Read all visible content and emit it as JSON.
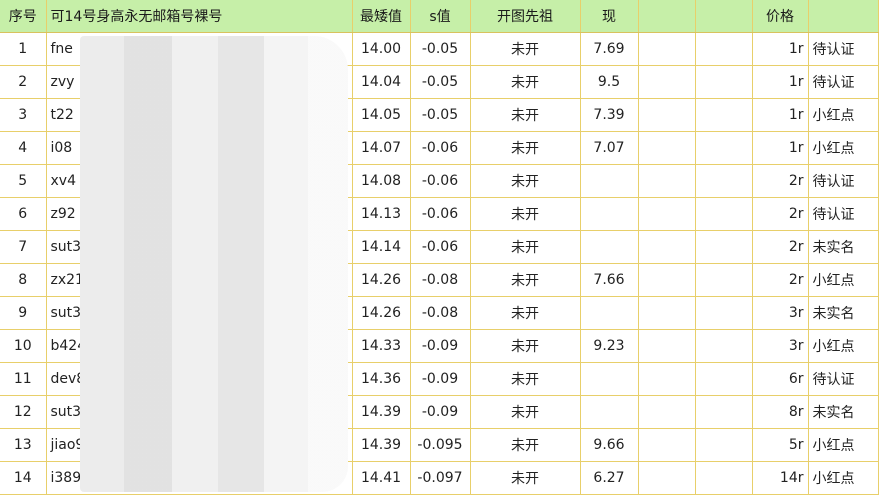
{
  "headers": [
    "序号",
    "可14号身高永无邮箱号裸号",
    "最矮值",
    "s值",
    "开图先祖",
    "现",
    "",
    "",
    "价格",
    ""
  ],
  "rows": [
    {
      "idx": "1",
      "user": "fne",
      "min": "14.00",
      "s": "-0.05",
      "ancestor": "未开",
      "now": "7.69",
      "price": "1r",
      "status": "待认证"
    },
    {
      "idx": "2",
      "user": "zvy",
      "min": "14.04",
      "s": "-0.05",
      "ancestor": "未开",
      "now": "9.5",
      "price": "1r",
      "status": "待认证"
    },
    {
      "idx": "3",
      "user": "t22",
      "min": "14.05",
      "s": "-0.05",
      "ancestor": "未开",
      "now": "7.39",
      "price": "1r",
      "status": "小红点"
    },
    {
      "idx": "4",
      "user": "i08",
      "min": "14.07",
      "s": "-0.06",
      "ancestor": "未开",
      "now": "7.07",
      "price": "1r",
      "status": "小红点"
    },
    {
      "idx": "5",
      "user": "xv4",
      "min": "14.08",
      "s": "-0.06",
      "ancestor": "未开",
      "now": "",
      "price": "2r",
      "status": "待认证"
    },
    {
      "idx": "6",
      "user": "z92",
      "min": "14.13",
      "s": "-0.06",
      "ancestor": "未开",
      "now": "",
      "price": "2r",
      "status": "待认证"
    },
    {
      "idx": "7",
      "user": "sut3",
      "min": "14.14",
      "s": "-0.06",
      "ancestor": "未开",
      "now": "",
      "price": "2r",
      "status": "未实名"
    },
    {
      "idx": "8",
      "user": "zx215",
      "min": "14.26",
      "s": "-0.08",
      "ancestor": "未开",
      "now": "7.66",
      "price": "2r",
      "status": "小红点"
    },
    {
      "idx": "9",
      "user": "sut38",
      "min": "14.26",
      "s": "-0.08",
      "ancestor": "未开",
      "now": "",
      "price": "3r",
      "status": "未实名"
    },
    {
      "idx": "10",
      "user": "b4249",
      "min": "14.33",
      "s": "-0.09",
      "ancestor": "未开",
      "now": "9.23",
      "price": "3r",
      "status": "小红点"
    },
    {
      "idx": "11",
      "user": "dev84",
      "min": "14.36",
      "s": "-0.09",
      "ancestor": "未开",
      "now": "",
      "price": "6r",
      "status": "待认证"
    },
    {
      "idx": "12",
      "user": "sut381",
      "min": "14.39",
      "s": "-0.09",
      "ancestor": "未开",
      "now": "",
      "price": "8r",
      "status": "未实名"
    },
    {
      "idx": "13",
      "user": "jiao99",
      "min": "14.39",
      "s": "-0.095",
      "ancestor": "未开",
      "now": "9.66",
      "price": "5r",
      "status": "小红点"
    },
    {
      "idx": "14",
      "user": "i38930",
      "min": "14.41",
      "s": "-0.097",
      "ancestor": "未开",
      "now": "6.27",
      "price": "14r",
      "status": "小红点"
    }
  ]
}
